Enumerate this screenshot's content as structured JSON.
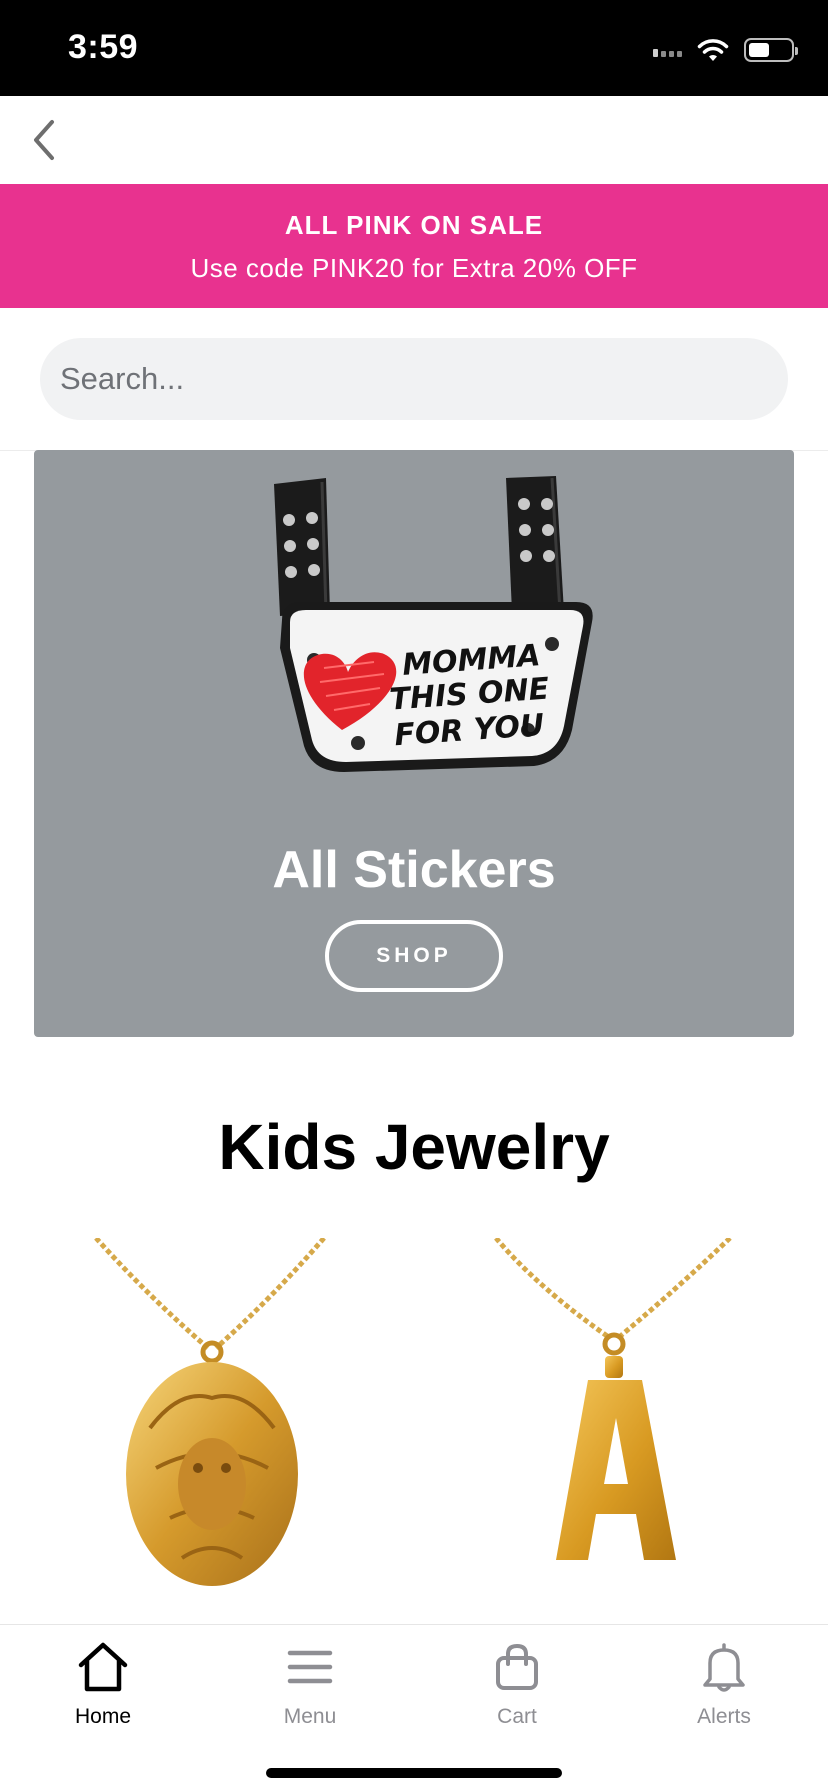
{
  "status_bar": {
    "time": "3:59"
  },
  "nav": {
    "back_icon": "chevron-left-icon"
  },
  "promo": {
    "title": "ALL PINK ON SALE",
    "subtitle": "Use code PINK20 for Extra 20% OFF",
    "background_color": "#e8328f"
  },
  "search": {
    "placeholder": "Search..."
  },
  "hero": {
    "sticker_text": [
      "MOMMA",
      "THIS ONE",
      "FOR YOU"
    ],
    "title": "All Stickers",
    "button_label": "SHOP",
    "background_color": "#959a9e"
  },
  "section": {
    "title": "Kids Jewelry"
  },
  "products": [
    {
      "image": "gold lion head pendant necklace"
    },
    {
      "image": "gold letter A pendant necklace"
    }
  ],
  "tabs": [
    {
      "label": "Home",
      "icon": "home-icon",
      "active": true
    },
    {
      "label": "Menu",
      "icon": "menu-icon",
      "active": false
    },
    {
      "label": "Cart",
      "icon": "bag-icon",
      "active": false
    },
    {
      "label": "Alerts",
      "icon": "bell-icon",
      "active": false
    }
  ]
}
